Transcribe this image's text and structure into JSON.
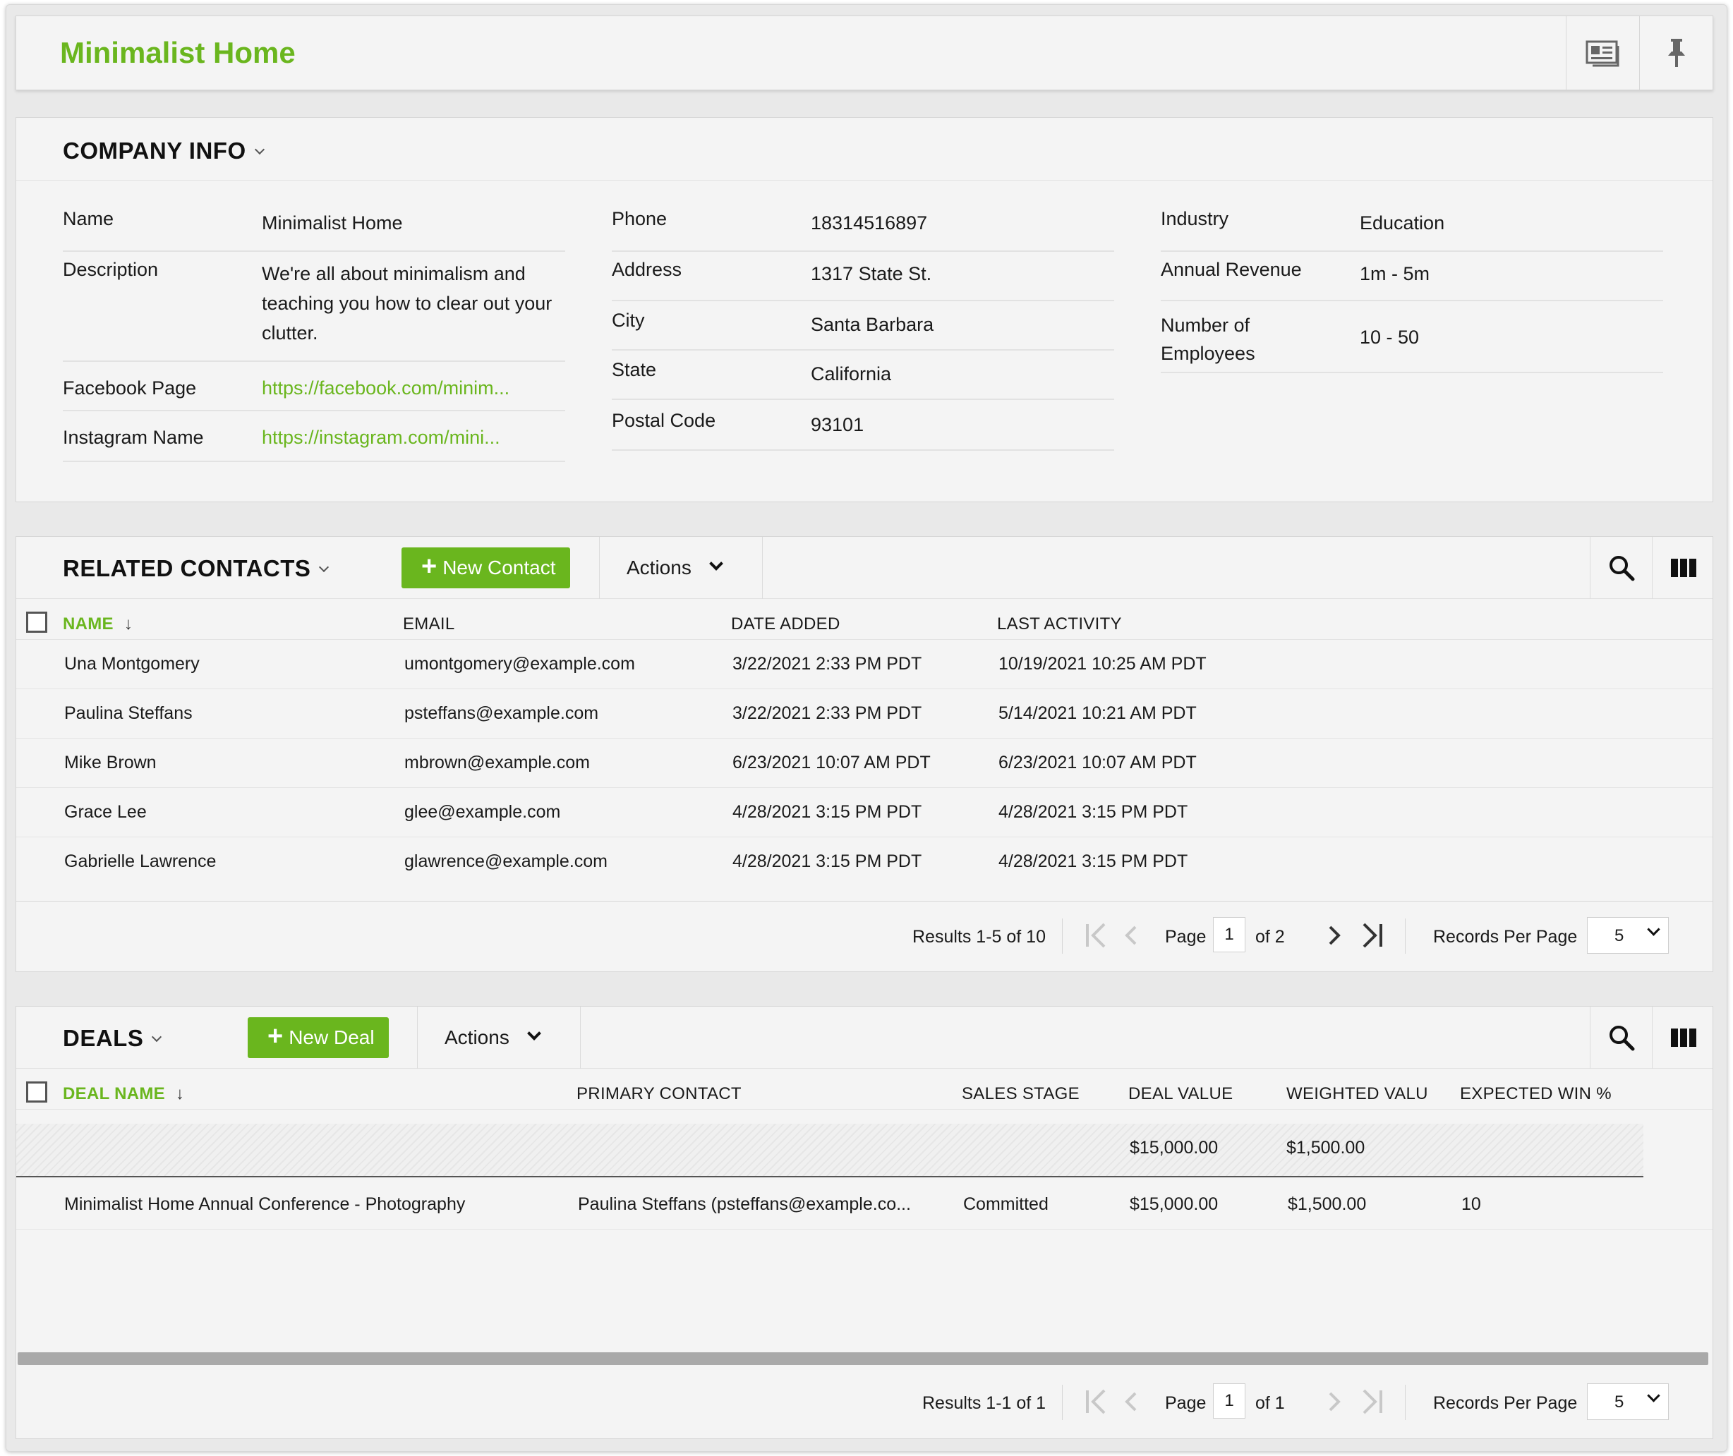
{
  "header": {
    "title": "Minimalist Home",
    "icons": [
      "card-icon",
      "pin-icon"
    ]
  },
  "company_info": {
    "title": "COMPANY INFO",
    "col1": [
      {
        "label": "Name",
        "value": "Minimalist Home"
      },
      {
        "label": "Description",
        "value": "We're all about minimalism and teaching you how to clear out your clutter."
      },
      {
        "label": "Facebook Page",
        "value": "https://facebook.com/minim..."
      },
      {
        "label": "Instagram Name",
        "value": "https://instagram.com/mini..."
      }
    ],
    "col2": [
      {
        "label": "Phone",
        "value": "18314516897"
      },
      {
        "label": "Address",
        "value": "1317 State St."
      },
      {
        "label": "City",
        "value": "Santa Barbara"
      },
      {
        "label": "State",
        "value": "California"
      },
      {
        "label": "Postal Code",
        "value": "93101"
      }
    ],
    "col3": [
      {
        "label": "Industry",
        "value": "Education"
      },
      {
        "label": "Annual Revenue",
        "value": "1m - 5m"
      },
      {
        "label": "Number of Employees",
        "value": "10 - 50"
      }
    ]
  },
  "contacts": {
    "title": "RELATED CONTACTS",
    "new_button": "New Contact",
    "actions_label": "Actions",
    "columns": [
      "NAME",
      "EMAIL",
      "DATE ADDED",
      "LAST ACTIVITY"
    ],
    "sort_arrow": "↓",
    "rows": [
      [
        "Una Montgomery",
        "umontgomery@example.com",
        "3/22/2021 2:33 PM PDT",
        "10/19/2021 10:25 AM PDT"
      ],
      [
        "Paulina Steffans",
        "psteffans@example.com",
        "3/22/2021 2:33 PM PDT",
        "5/14/2021 10:21 AM PDT"
      ],
      [
        "Mike Brown",
        "mbrown@example.com",
        "6/23/2021 10:07 AM PDT",
        "6/23/2021 10:07 AM PDT"
      ],
      [
        "Grace Lee",
        "glee@example.com",
        "4/28/2021 3:15 PM PDT",
        "4/28/2021 3:15 PM PDT"
      ],
      [
        "Gabrielle Lawrence",
        "glawrence@example.com",
        "4/28/2021 3:15 PM PDT",
        "4/28/2021 3:15 PM PDT"
      ]
    ],
    "pager": {
      "results": "Results  1-5  of  10",
      "page_label": "Page",
      "page": "1",
      "of_label": "of  2",
      "rpp_label": "Records Per Page",
      "rpp": "5"
    }
  },
  "deals": {
    "title": "DEALS",
    "new_button": "New Deal",
    "actions_label": "Actions",
    "columns": [
      "DEAL NAME",
      "PRIMARY CONTACT",
      "SALES STAGE",
      "DEAL VALUE",
      "WEIGHTED VALU",
      "EXPECTED WIN %"
    ],
    "sort_arrow": "↓",
    "totals": {
      "deal_value": "$15,000.00",
      "weighted_value": "$1,500.00"
    },
    "rows": [
      [
        "Minimalist Home Annual Conference - Photography",
        "Paulina Steffans (psteffans@example.co...",
        "Committed",
        "$15,000.00",
        "$1,500.00",
        "10"
      ]
    ],
    "pager": {
      "results": "Results  1-1  of  1",
      "page_label": "Page",
      "page": "1",
      "of_label": "of  1",
      "rpp_label": "Records Per Page",
      "rpp": "5"
    }
  },
  "colors": {
    "accent": "#6ab61e",
    "panel": "#f4f4f4",
    "background": "#e9e9e9"
  }
}
